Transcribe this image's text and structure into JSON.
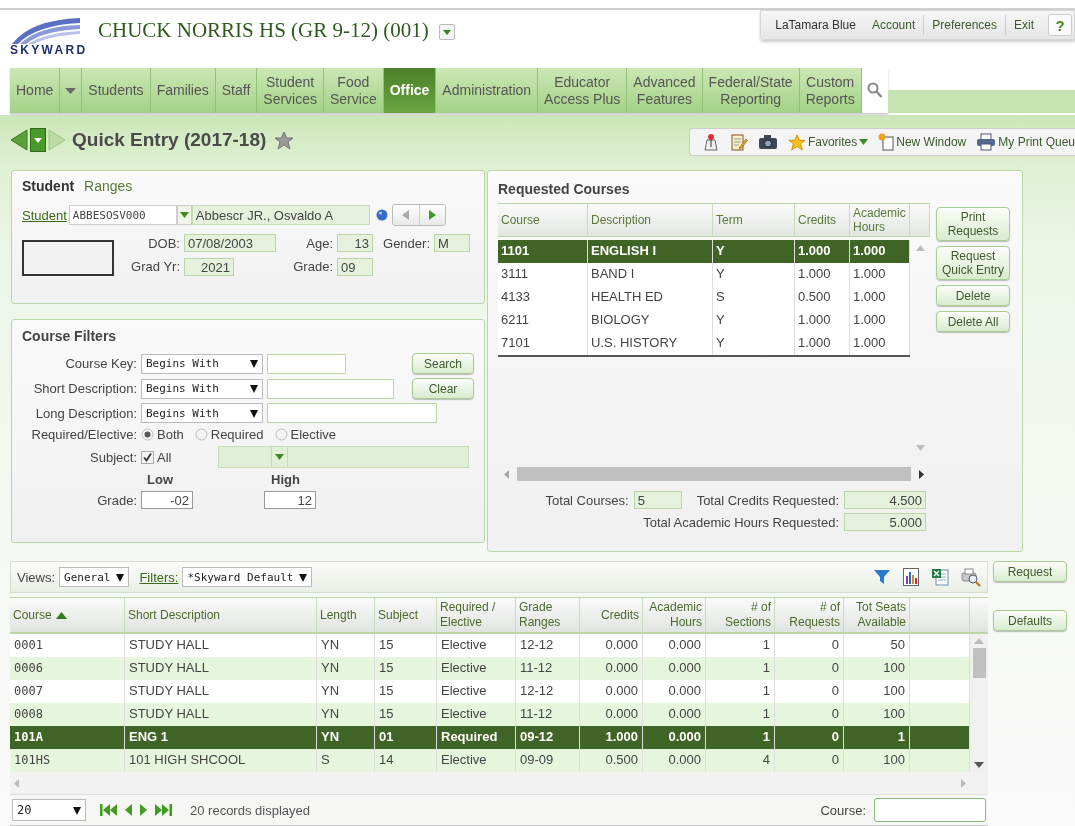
{
  "header": {
    "logo": "SKYWARD",
    "school": "CHUCK NORRIS HS (GR 9-12) (001)",
    "user_menu": [
      {
        "label": "LaTamara Blue",
        "kind": "user"
      },
      {
        "label": "Account",
        "kind": "link"
      },
      {
        "label": "Preferences",
        "kind": "link"
      },
      {
        "label": "Exit",
        "kind": "link"
      },
      {
        "label": "?",
        "kind": "help"
      }
    ]
  },
  "nav": [
    {
      "lines": [
        "Home"
      ],
      "selected": false,
      "menu": true
    },
    {
      "lines": [
        "Students"
      ],
      "selected": false,
      "menu": false
    },
    {
      "lines": [
        "Families"
      ],
      "selected": false,
      "menu": false
    },
    {
      "lines": [
        "Staff"
      ],
      "selected": false,
      "menu": false
    },
    {
      "lines": [
        "Student",
        "Services"
      ],
      "selected": false,
      "menu": false
    },
    {
      "lines": [
        "Food",
        "Service"
      ],
      "selected": false,
      "menu": false
    },
    {
      "lines": [
        "Office"
      ],
      "selected": true,
      "menu": false
    },
    {
      "lines": [
        "Administration"
      ],
      "selected": false,
      "menu": false
    },
    {
      "lines": [
        "Educator",
        "Access Plus"
      ],
      "selected": false,
      "menu": false
    },
    {
      "lines": [
        "Advanced",
        "Features"
      ],
      "selected": false,
      "menu": false
    },
    {
      "lines": [
        "Federal/State",
        "Reporting"
      ],
      "selected": false,
      "menu": false
    },
    {
      "lines": [
        "Custom",
        "Reports"
      ],
      "selected": false,
      "menu": false
    }
  ],
  "page": {
    "title": "Quick Entry (2017-18)",
    "toolbar": [
      {
        "kind": "map"
      },
      {
        "kind": "notes"
      },
      {
        "kind": "camera"
      },
      {
        "kind": "favorites",
        "label": "Favorites"
      },
      {
        "kind": "new_window",
        "label": "New Window"
      },
      {
        "kind": "print_queue",
        "label": "My Print Queu"
      }
    ]
  },
  "student": {
    "tabs": [
      {
        "label": "Student",
        "selected": true
      },
      {
        "label": "Ranges",
        "selected": false
      }
    ],
    "link": "Student",
    "id": "ABBESOSV000",
    "name": "Abbescr JR., Osvaldo A",
    "fields": [
      {
        "label": "DOB:",
        "value": "07/08/2003"
      },
      {
        "label": "Age:",
        "value": "13"
      },
      {
        "label": "Gender:",
        "value": "M"
      },
      {
        "label": "Grad Yr:",
        "value": "2021"
      },
      {
        "label": "Grade:",
        "value": "09"
      }
    ]
  },
  "filters": {
    "title": "Course Filters",
    "rows": [
      {
        "label": "Course Key:",
        "mode": "Begins With"
      },
      {
        "label": "Short Description:",
        "mode": "Begins With"
      },
      {
        "label": "Long Description:",
        "mode": "Begins With"
      }
    ],
    "buttons": [
      "Search",
      "Clear"
    ],
    "required_elective": {
      "label": "Required/Elective:",
      "options": [
        {
          "label": "Both",
          "selected": true
        },
        {
          "label": "Required",
          "selected": false
        },
        {
          "label": "Elective",
          "selected": false
        }
      ]
    },
    "subject": {
      "label": "Subject:",
      "all_label": "All",
      "checked": true
    },
    "grade": {
      "label": "Grade:",
      "low_label": "Low",
      "high_label": "High",
      "low": "-02",
      "high": "12"
    }
  },
  "requested": {
    "title": "Requested Courses",
    "columns": [
      "Course",
      "Description",
      "Term",
      "Credits",
      "Academic Hours"
    ],
    "rows": [
      {
        "cells": [
          "1101",
          "ENGLISH I",
          "Y",
          "1.000",
          "1.000"
        ],
        "selected": true
      },
      {
        "cells": [
          "3111",
          "BAND I",
          "Y",
          "1.000",
          "1.000"
        ],
        "selected": false
      },
      {
        "cells": [
          "4133",
          "HEALTH ED",
          "S",
          "0.500",
          "1.000"
        ],
        "selected": false
      },
      {
        "cells": [
          "6211",
          "BIOLOGY",
          "Y",
          "1.000",
          "1.000"
        ],
        "selected": false
      },
      {
        "cells": [
          "7101",
          "U.S. HISTORY",
          "Y",
          "1.000",
          "1.000"
        ],
        "selected": false
      }
    ],
    "buttons": [
      "Print Requests",
      "Request Quick Entry",
      "Delete",
      "Delete All"
    ],
    "totals": [
      {
        "label": "Total Courses:",
        "value": "5"
      },
      {
        "label": "Total Credits Requested:",
        "value": "4.500"
      },
      {
        "label": "Total Academic Hours Requested:",
        "value": "5.000"
      }
    ]
  },
  "courses": {
    "views_label": "Views:",
    "view": "General",
    "filters_label": "Filters:",
    "filter": "*Skyward Default",
    "columns": [
      {
        "label": "Course",
        "sorted": true
      },
      {
        "label": "Short Description",
        "sorted": false
      },
      {
        "label": "Length",
        "sorted": false
      },
      {
        "label": "Subject",
        "sorted": false
      },
      {
        "label": "Required / Elective",
        "sorted": false
      },
      {
        "label": "Grade Ranges",
        "sorted": false
      },
      {
        "label": "Credits",
        "sorted": false
      },
      {
        "label": "Academic Hours",
        "sorted": false
      },
      {
        "label": "# of Sections",
        "sorted": false
      },
      {
        "label": "# of Requests",
        "sorted": false
      },
      {
        "label": "Tot Seats Available",
        "sorted": false
      }
    ],
    "rows": [
      {
        "cells": [
          "0001",
          "STUDY HALL",
          "YN",
          "15",
          "Elective",
          "12-12",
          "0.000",
          "0.000",
          "1",
          "0",
          "50"
        ],
        "selected": false
      },
      {
        "cells": [
          "0006",
          "STUDY HALL",
          "YN",
          "15",
          "Elective",
          "11-12",
          "0.000",
          "0.000",
          "1",
          "0",
          "100"
        ],
        "selected": false
      },
      {
        "cells": [
          "0007",
          "STUDY HALL",
          "YN",
          "15",
          "Elective",
          "12-12",
          "0.000",
          "0.000",
          "1",
          "0",
          "100"
        ],
        "selected": false
      },
      {
        "cells": [
          "0008",
          "STUDY HALL",
          "YN",
          "15",
          "Elective",
          "11-12",
          "0.000",
          "0.000",
          "1",
          "0",
          "100"
        ],
        "selected": false
      },
      {
        "cells": [
          "101A",
          "ENG 1",
          "YN",
          "01",
          "Required",
          "09-12",
          "1.000",
          "0.000",
          "1",
          "0",
          "1"
        ],
        "selected": true
      },
      {
        "cells": [
          "101HS",
          "101 HIGH SHCOOL",
          "S",
          "14",
          "Elective",
          "09-09",
          "0.500",
          "0.000",
          "4",
          "0",
          "100"
        ],
        "selected": false
      }
    ],
    "page_size": "20",
    "records": "20 records displayed",
    "course_label": "Course:",
    "buttons": [
      "Request",
      "Defaults"
    ]
  }
}
